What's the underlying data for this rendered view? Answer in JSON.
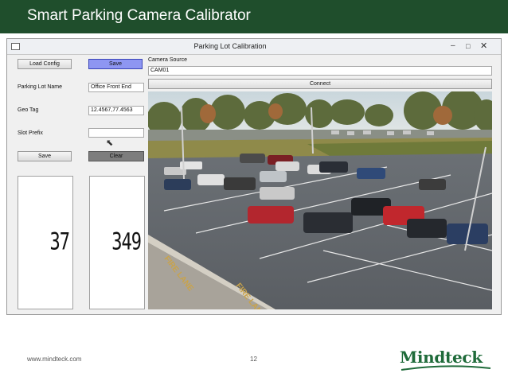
{
  "slide": {
    "title": "Smart Parking Camera Calibrator",
    "footer_url": "www.mindteck.com",
    "page_number": "12",
    "logo_text": "Mindteck",
    "colors": {
      "title_bar": "#1f4e2c",
      "logo": "#1f6b3a",
      "save_button": "#8e96f2",
      "clear_button": "#7d7d7d"
    }
  },
  "window": {
    "title": "Parking Lot Calibration",
    "controls": {
      "minimize": "–",
      "maximize": "□",
      "close": "✕"
    }
  },
  "left_panel": {
    "load_config_label": "Load Config",
    "save_top_label": "Save",
    "parking_lot_name_label": "Parking Lot Name",
    "parking_lot_name_value": "Office Front End",
    "geo_tag_label": "Geo Tag",
    "geo_tag_value": "12.4567,77.4563",
    "slot_prefix_label": "Slot Prefix",
    "slot_prefix_value": "",
    "save_bottom_label": "Save",
    "clear_label": "Clear",
    "counter_left": "37",
    "counter_right": "349"
  },
  "camera": {
    "source_label": "Camera Source",
    "source_value": "CAM01",
    "connect_label": "Connect"
  },
  "icons": [
    "window-app-icon",
    "minimize-icon",
    "maximize-icon",
    "close-icon",
    "mouse-cursor-icon"
  ]
}
